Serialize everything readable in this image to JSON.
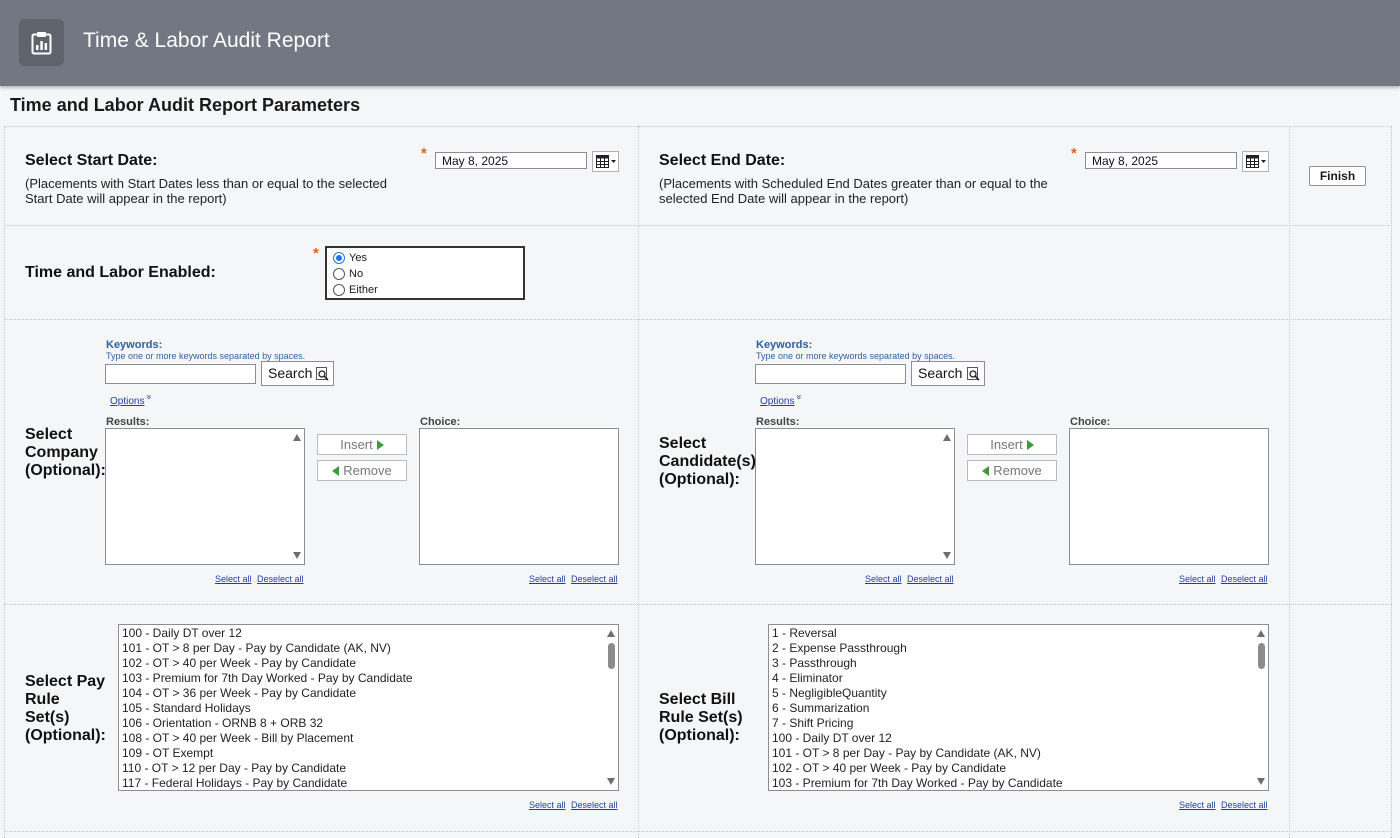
{
  "header": {
    "title": "Time & Labor Audit Report",
    "icon": "clipboard-report-icon"
  },
  "page": {
    "title": "Time and Labor Audit Report Parameters"
  },
  "start_date": {
    "label": "Select Start Date:",
    "note_line1": "(Placements with Start Dates less than or equal to the selected",
    "note_line2": "Start Date will appear in the report)",
    "value": "May 8, 2025",
    "required_marker": "*"
  },
  "end_date": {
    "label": "Select End Date:",
    "note_line1": "(Placements with Scheduled End Dates greater than or equal to the",
    "note_line2": "selected End Date will appear in the report)",
    "value": "May 8, 2025",
    "required_marker": "*"
  },
  "finish_label": "Finish",
  "time_labor": {
    "label": "Time and Labor Enabled:",
    "required_marker": "*",
    "options": [
      "Yes",
      "No",
      "Either"
    ],
    "selected": "Yes"
  },
  "company": {
    "label_line1": "Select",
    "label_line2": "Company",
    "label_line3": "(Optional):"
  },
  "candidate": {
    "label_line1": "Select",
    "label_line2": "Candidate(s)",
    "label_line3": "(Optional):"
  },
  "picker": {
    "keywords_label": "Keywords:",
    "keywords_hint": "Type one or more keywords separated by spaces.",
    "keywords_value": "",
    "search_label": "Search",
    "options_label": "Options",
    "options_chevron": "»",
    "results_label": "Results:",
    "choice_label": "Choice:",
    "insert_label": "Insert",
    "remove_label": "Remove",
    "select_all": "Select all",
    "deselect_all": "Deselect all"
  },
  "pay_rules": {
    "label_line1": "Select Pay",
    "label_line2": "Rule",
    "label_line3": "Set(s)",
    "label_line4": "(Optional):",
    "items": [
      "100 - Daily DT over 12",
      "101 - OT > 8 per Day - Pay by Candidate (AK, NV)",
      "102 - OT > 40 per Week - Pay by Candidate",
      "103 - Premium for 7th Day Worked - Pay by Candidate",
      "104 - OT > 36 per Week - Pay by Candidate",
      "105 - Standard Holidays",
      "106 - Orientation - ORNB 8 + ORB 32",
      "108 - OT > 40 per Week - Bill by Placement",
      "109 - OT Exempt",
      "110 - OT > 12 per Day - Pay by Candidate",
      "117 - Federal Holidays - Pay by Candidate"
    ]
  },
  "bill_rules": {
    "label_line1": "Select Bill",
    "label_line2": "Rule Set(s)",
    "label_line3": "(Optional):",
    "items": [
      "1 - Reversal",
      "2 - Expense Passthrough",
      "3 - Passthrough",
      "4 - Eliminator",
      "5 - NegligibleQuantity",
      "6 - Summarization",
      "7 - Shift Pricing",
      "100 - Daily DT over 12",
      "101 - OT > 8 per Day - Pay by Candidate (AK, NV)",
      "102 - OT > 40 per Week - Pay by Candidate",
      "103 - Premium for 7th Day Worked - Pay by Candidate"
    ]
  },
  "colors": {
    "header_bg": "#737781",
    "required": "#e0621e",
    "link": "#1f3fa6",
    "radio_selected": "#1a73e8"
  }
}
